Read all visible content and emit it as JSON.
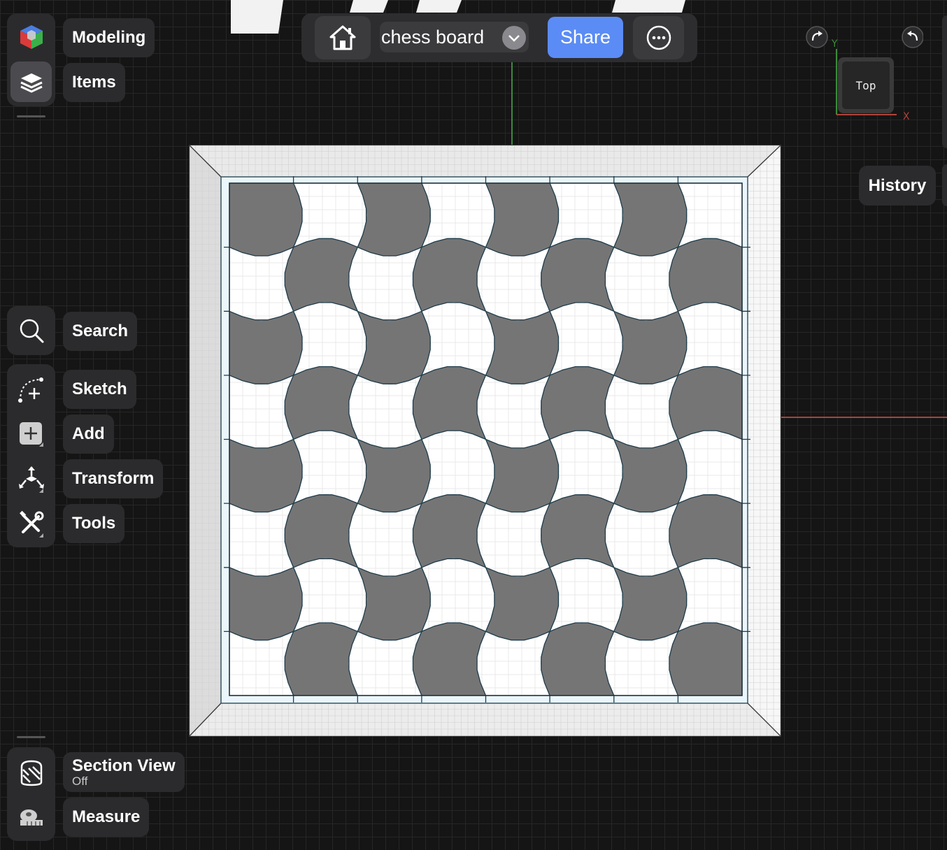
{
  "sidebar_top": {
    "items": [
      {
        "id": "modeling",
        "label": "Modeling",
        "icon": "cube-icon"
      },
      {
        "id": "items",
        "label": "Items",
        "icon": "layers-icon"
      }
    ]
  },
  "sidebar_mid": {
    "items": [
      {
        "id": "search",
        "label": "Search",
        "icon": "search-icon"
      },
      {
        "id": "sketch",
        "label": "Sketch",
        "icon": "sketch-icon"
      },
      {
        "id": "add",
        "label": "Add",
        "icon": "add-icon"
      },
      {
        "id": "transform",
        "label": "Transform",
        "icon": "transform-icon"
      },
      {
        "id": "tools",
        "label": "Tools",
        "icon": "tools-icon"
      }
    ]
  },
  "sidebar_bottom": {
    "section_view": {
      "label": "Section View",
      "status": "Off",
      "icon": "section-view-icon"
    },
    "measure": {
      "label": "Measure",
      "icon": "measure-tape-icon"
    }
  },
  "topbar": {
    "home_icon": "home-icon",
    "document_name": "chess board",
    "share_label": "Share",
    "more_icon": "more-icon"
  },
  "viewcube": {
    "face_label": "Top",
    "axis_x": "X",
    "axis_y": "Y",
    "redo_icon": "redo-icon",
    "undo_icon": "undo-icon"
  },
  "history_label": "History",
  "colors": {
    "accent": "#5b8cf5",
    "panel": "#2b2b2d",
    "dark_square": "#757575",
    "light_square": "#ffffff",
    "axis_x": "#b0433a",
    "axis_y": "#3b8a3b"
  }
}
